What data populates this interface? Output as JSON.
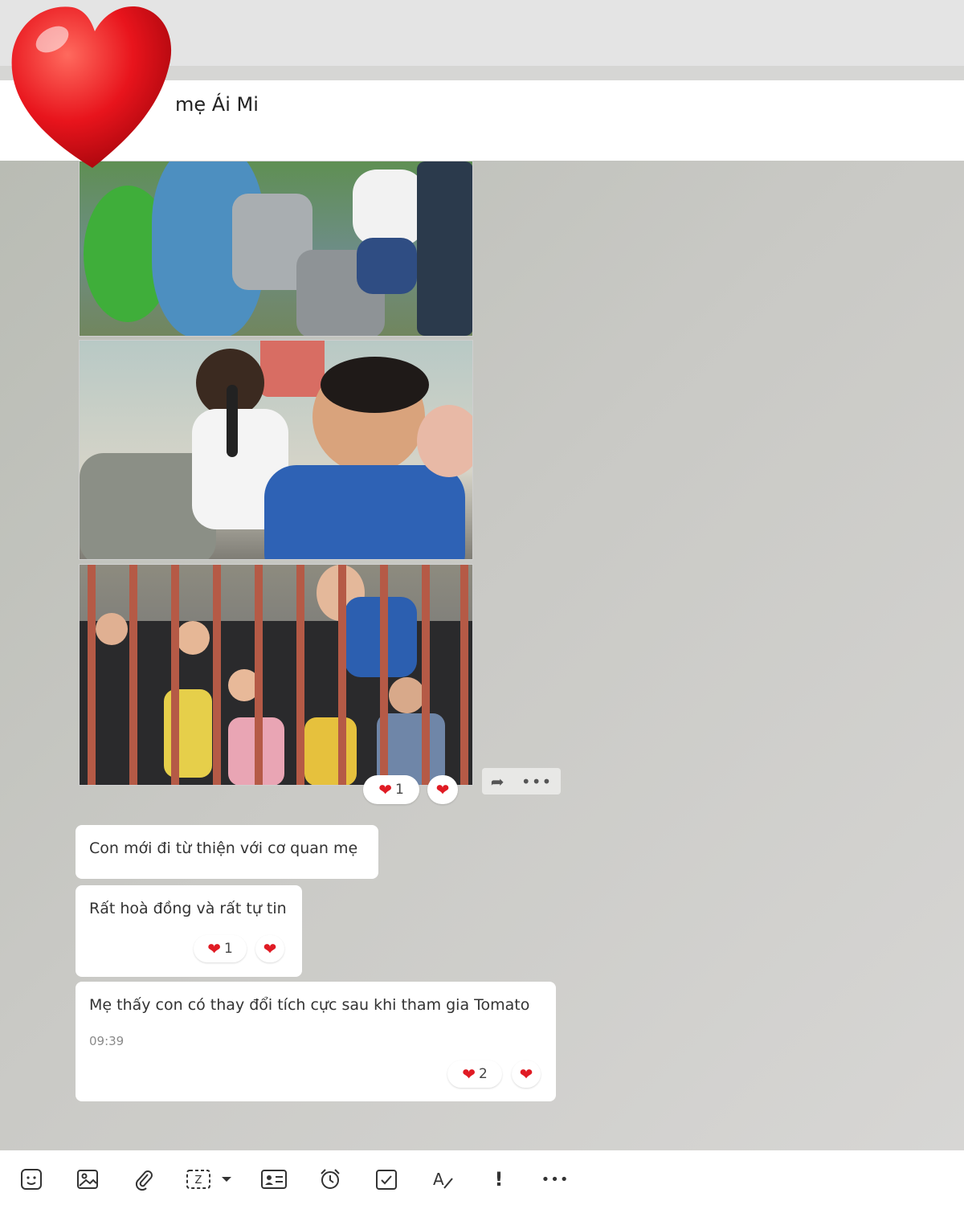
{
  "header": {
    "title": "mẹ Ái Mi"
  },
  "media": {
    "reaction_count": "1"
  },
  "messages": [
    {
      "text": "Con mới đi từ thiện với cơ quan mẹ"
    },
    {
      "text": "Rất hoà đồng và rất tự tin",
      "reaction_count": "1"
    },
    {
      "text": "Mẹ thấy con có thay đổi tích cực sau khi tham gia Tomato",
      "time": "09:39",
      "reaction_count": "2"
    }
  ],
  "colors": {
    "heart": "#e01b24",
    "header_bg": "#ffffff",
    "chat_bg": "#c9c9c5"
  },
  "icons": {
    "toolbar": [
      "sticker-icon",
      "image-icon",
      "attachment-icon",
      "screenshot-icon",
      "contact-card-icon",
      "reminder-icon",
      "task-icon",
      "format-text-icon",
      "important-icon",
      "more-icon"
    ],
    "actions": [
      "forward-icon",
      "more-icon"
    ]
  }
}
